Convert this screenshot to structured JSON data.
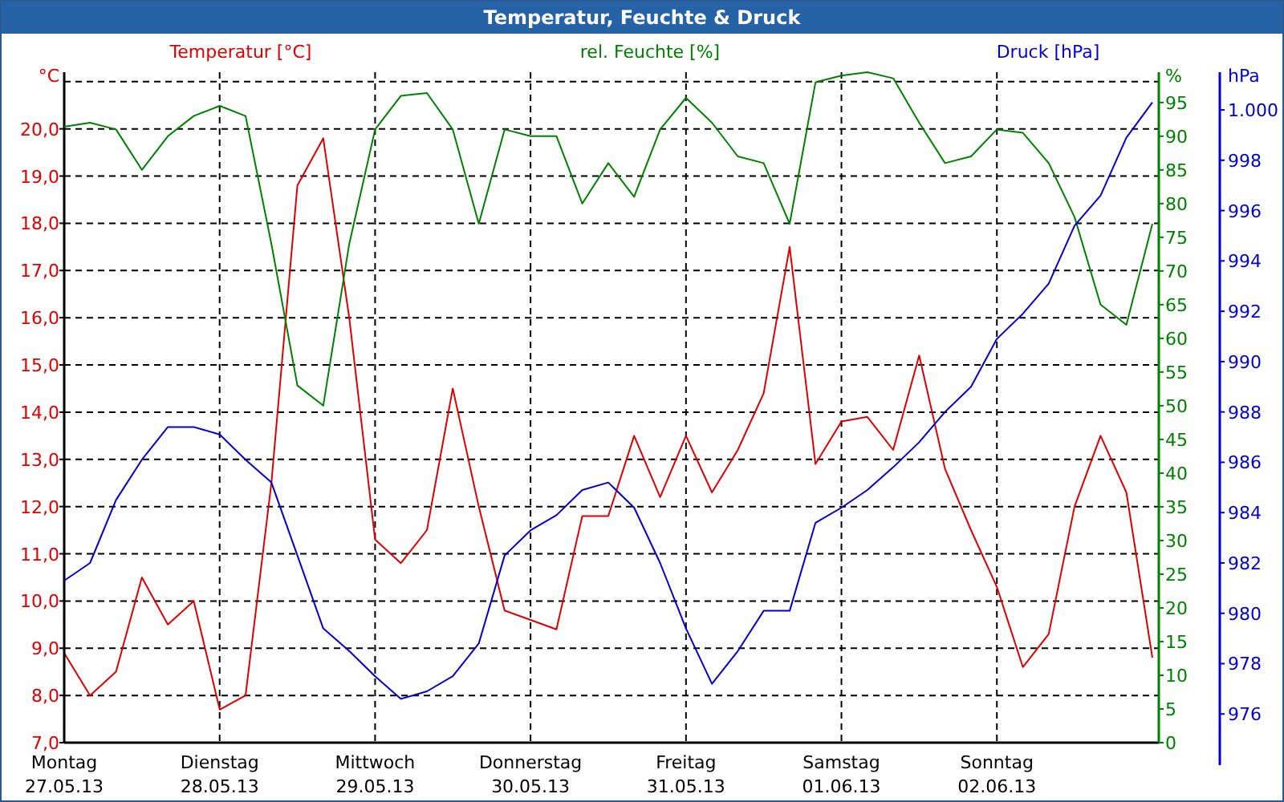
{
  "window": {
    "title": "Temperatur, Feuchte & Druck"
  },
  "chart": {
    "temperature": {
      "chart_data": {
        "type": "line",
        "ylabel": "°C",
        "categories": [
          "Montag",
          null,
          null,
          null,
          null,
          null,
          "Dienstag",
          null,
          null,
          null,
          null,
          null,
          "Mittwoch",
          null,
          null,
          null,
          null,
          null,
          "Donnerstag",
          null,
          null,
          null,
          null,
          null,
          "Freitag",
          null,
          null,
          null,
          null,
          null,
          "Samstag",
          null,
          null,
          null,
          null,
          null,
          "Sonntag",
          null,
          null,
          null,
          null,
          null,
          null
        ],
        "ylim": [
          7,
          21.2
        ],
        "yticks": [
          {
            "value": 20,
            "label": "20,0"
          },
          {
            "value": 19,
            "label": "19,0"
          },
          {
            "value": 18,
            "label": "18,0"
          },
          {
            "value": 17,
            "label": "17,0"
          },
          {
            "value": 16,
            "label": "16,0"
          },
          {
            "value": 15,
            "label": "15,0"
          },
          {
            "value": 14,
            "label": "14,0"
          },
          {
            "value": 13,
            "label": "13,0"
          },
          {
            "value": 12,
            "label": "12,0"
          },
          {
            "value": 11,
            "label": "11,0"
          },
          {
            "value": 10,
            "label": "10,0"
          },
          {
            "value": 9,
            "label": "9,0"
          },
          {
            "value": 8,
            "label": "8,0"
          },
          {
            "value": 7,
            "label": "7,0"
          }
        ],
        "series": [
          {
            "name": "Temperatur [°C]",
            "color": "#dd0000",
            "values": [
              8.9,
              8.0,
              8.5,
              10.5,
              9.5,
              10.0,
              7.7,
              8.0,
              12.5,
              18.8,
              19.8,
              16,
              11.3,
              10.8,
              11.5,
              14.5,
              12,
              9.8,
              9.6,
              9.4,
              11.8,
              11.8,
              13.5,
              12.2,
              13.5,
              12.3,
              13.2,
              14.4,
              17.5,
              12.9,
              13.8,
              13.9,
              13.2,
              15.2,
              12.8,
              11.5,
              10.3,
              8.6,
              9.3,
              12,
              13.5,
              12.3,
              8.8
            ]
          }
        ]
      }
    },
    "humidity": {
      "chart_data": {
        "type": "line",
        "ylabel": "%",
        "ylim": [
          0,
          99.5
        ],
        "yticks": [
          95,
          90,
          85,
          80,
          75,
          70,
          65,
          60,
          55,
          50,
          45,
          40,
          35,
          30,
          25,
          20,
          15,
          10,
          5,
          0
        ],
        "series": [
          {
            "name": "rel. Feuchte [%]",
            "color": "#008000",
            "values": [
              91.4,
              92,
              91,
              85,
              90,
              93,
              94.5,
              93,
              74,
              53,
              50,
              74,
              91,
              96,
              96.4,
              91,
              77,
              91,
              90,
              90,
              80,
              86,
              81,
              91,
              95.7,
              92,
              87,
              86,
              77,
              98,
              99,
              99.5,
              98.6,
              92,
              86,
              87,
              91,
              90.5,
              86,
              78,
              65,
              62,
              77
            ]
          }
        ]
      }
    },
    "pressure": {
      "chart_data": {
        "type": "line",
        "ylabel": "hPa",
        "ylim": [
          974,
          1001.5
        ],
        "yticks": [
          {
            "value": 1000,
            "label": "1.000"
          },
          998,
          996,
          994,
          992,
          990,
          988,
          986,
          984,
          982,
          980,
          978,
          976
        ],
        "series": [
          {
            "name": "Druck [hPa]",
            "color": "#0000cc",
            "values": [
              981.3,
              982,
              984.5,
              986.1,
              987.4,
              987.4,
              987.1,
              986.1,
              985.2,
              982.3,
              979.4,
              978.5,
              977.5,
              976.6,
              976.9,
              977.5,
              978.8,
              982.3,
              983.3,
              983.9,
              984.9,
              985.2,
              984.2,
              982,
              979.4,
              977.2,
              978.5,
              980.1,
              980.1,
              983.6,
              984.2,
              984.9,
              985.8,
              986.8,
              988,
              989,
              990.9,
              991.9,
              993.1,
              995.4,
              996.6,
              998.9,
              1000.3
            ]
          }
        ]
      }
    },
    "dates": [
      "27.05.13",
      "28.05.13",
      "29.05.13",
      "30.05.13",
      "31.05.13",
      "01.06.13",
      "02.06.13"
    ]
  }
}
